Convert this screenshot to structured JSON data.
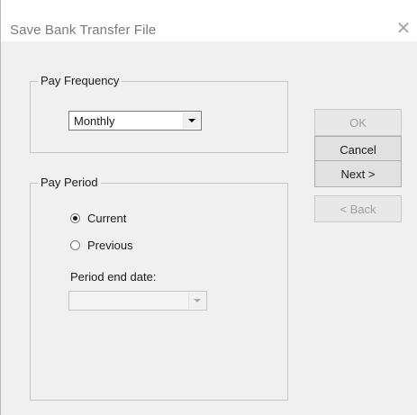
{
  "window": {
    "title": "Save Bank Transfer File",
    "close_glyph": "✕"
  },
  "pay_frequency": {
    "legend": "Pay Frequency",
    "selected": "Monthly"
  },
  "pay_period": {
    "legend": "Pay Period",
    "options": [
      {
        "label": "Current",
        "checked": true
      },
      {
        "label": "Previous",
        "checked": false
      }
    ],
    "end_date_label": "Period end date:",
    "end_date_value": ""
  },
  "buttons": {
    "ok": "OK",
    "cancel": "Cancel",
    "next": "Next >",
    "back": "< Back"
  },
  "icons": {
    "dropdown": "chevron-down-icon",
    "close": "close-icon"
  }
}
